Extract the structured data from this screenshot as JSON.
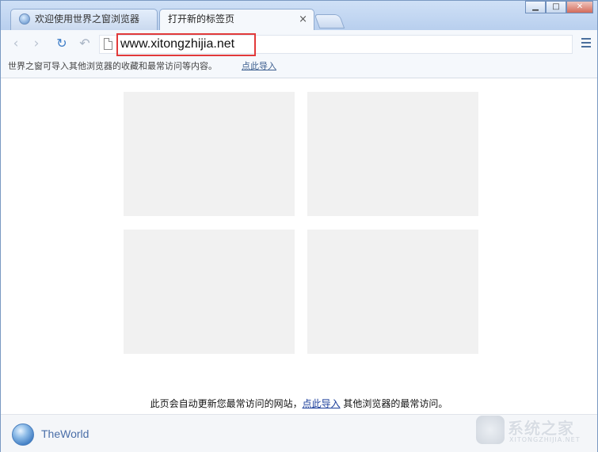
{
  "window": {
    "minimize_label": "▁",
    "maximize_label": "□",
    "close_label": "✕"
  },
  "tabs": [
    {
      "label": "欢迎使用世界之窗浏览器",
      "active": false
    },
    {
      "label": "打开新的标签页",
      "active": true,
      "close_label": "×"
    }
  ],
  "toolbar": {
    "back_icon": "‹",
    "forward_icon": "›",
    "refresh_icon": "↻",
    "undo_icon": "↶",
    "url": "www.xitongzhijia.net"
  },
  "infobar": {
    "message": "世界之窗可导入其他浏览器的收藏和最常访问等内容。",
    "link": "点此导入"
  },
  "main": {
    "tiles_count_visible": 4,
    "footnote_before": "此页会自动更新您最常访问的网站，",
    "footnote_link": "点此导入",
    "footnote_after": " 其他浏览器的最常访问。"
  },
  "bottom": {
    "brand": "TheWorld"
  },
  "watermark": {
    "text": "系统之家",
    "sub": "XITONGZHIJIA.NET"
  },
  "colors": {
    "accent_highlight": "#e23a3a",
    "link": "#1a3d9a",
    "tile": "#f1f1f1"
  }
}
